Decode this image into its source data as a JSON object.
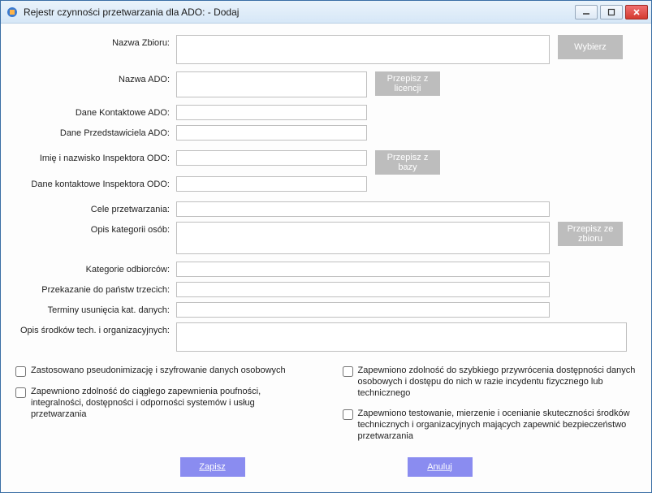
{
  "window": {
    "title": "Rejestr czynności przetwarzania dla ADO: - Dodaj"
  },
  "labels": {
    "nazwa_zbioru": "Nazwa Zbioru:",
    "nazwa_ado": "Nazwa ADO:",
    "dane_kontaktowe_ado": "Dane Kontaktowe ADO:",
    "dane_przedstawiciela_ado": "Dane Przedstawiciela ADO:",
    "imie_inspektora": "Imię i nazwisko Inspektora ODO:",
    "dane_inspektora": "Dane kontaktowe Inspektora ODO:",
    "cele_przetwarzania": "Cele przetwarzania:",
    "opis_kategorii_osob": "Opis kategorii osób:",
    "kategorie_odbiorcow": "Kategorie odbiorców:",
    "przekazanie_panstw": "Przekazanie do państw trzecich:",
    "terminy_usuniecia": "Terminy usunięcia kat. danych:",
    "opis_srodkow": "Opis środków tech. i organizacyjnych:"
  },
  "buttons": {
    "wybierz": "Wybierz",
    "przepisz_licencji": "Przepisz z licencji",
    "przepisz_bazy": "Przepisz z bazy",
    "przepisz_zbioru": "Przepisz ze zbioru",
    "zapisz": "Zapisz",
    "anuluj": "Anuluj"
  },
  "checkboxes": {
    "pseudonimizacja": "Zastosowano pseudonimizację i szyfrowanie danych osobowych",
    "poufnosc": "Zapewniono zdolność do ciągłego zapewnienia poufności, integralności, dostępności i odporności systemów i usług przetwarzania",
    "przywrocenie": "Zapewniono zdolność do szybkiego przywrócenia dostępności danych osobowych i dostępu do nich w razie incydentu fizycznego lub technicznego",
    "testowanie": "Zapewniono testowanie, mierzenie i ocenianie skuteczności środków technicznych i organizacyjnych mających zapewnić bezpieczeństwo przetwarzania"
  },
  "fields": {
    "nazwa_zbioru": "",
    "nazwa_ado": "",
    "dane_kontaktowe_ado": "",
    "dane_przedstawiciela_ado": "",
    "imie_inspektora": "",
    "dane_inspektora": "",
    "cele_przetwarzania": "",
    "opis_kategorii_osob": "",
    "kategorie_odbiorcow": "",
    "przekazanie_panstw": "",
    "terminy_usuniecia": "",
    "opis_srodkow": ""
  }
}
